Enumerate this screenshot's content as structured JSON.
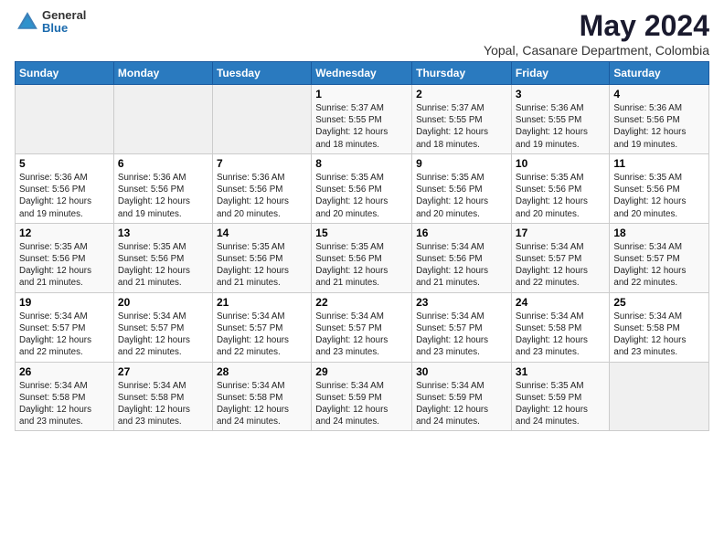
{
  "logo": {
    "general": "General",
    "blue": "Blue"
  },
  "title": "May 2024",
  "subtitle": "Yopal, Casanare Department, Colombia",
  "days_of_week": [
    "Sunday",
    "Monday",
    "Tuesday",
    "Wednesday",
    "Thursday",
    "Friday",
    "Saturday"
  ],
  "weeks": [
    [
      {
        "day": "",
        "info": ""
      },
      {
        "day": "",
        "info": ""
      },
      {
        "day": "",
        "info": ""
      },
      {
        "day": "1",
        "info": "Sunrise: 5:37 AM\nSunset: 5:55 PM\nDaylight: 12 hours\nand 18 minutes."
      },
      {
        "day": "2",
        "info": "Sunrise: 5:37 AM\nSunset: 5:55 PM\nDaylight: 12 hours\nand 18 minutes."
      },
      {
        "day": "3",
        "info": "Sunrise: 5:36 AM\nSunset: 5:55 PM\nDaylight: 12 hours\nand 19 minutes."
      },
      {
        "day": "4",
        "info": "Sunrise: 5:36 AM\nSunset: 5:56 PM\nDaylight: 12 hours\nand 19 minutes."
      }
    ],
    [
      {
        "day": "5",
        "info": "Sunrise: 5:36 AM\nSunset: 5:56 PM\nDaylight: 12 hours\nand 19 minutes."
      },
      {
        "day": "6",
        "info": "Sunrise: 5:36 AM\nSunset: 5:56 PM\nDaylight: 12 hours\nand 19 minutes."
      },
      {
        "day": "7",
        "info": "Sunrise: 5:36 AM\nSunset: 5:56 PM\nDaylight: 12 hours\nand 20 minutes."
      },
      {
        "day": "8",
        "info": "Sunrise: 5:35 AM\nSunset: 5:56 PM\nDaylight: 12 hours\nand 20 minutes."
      },
      {
        "day": "9",
        "info": "Sunrise: 5:35 AM\nSunset: 5:56 PM\nDaylight: 12 hours\nand 20 minutes."
      },
      {
        "day": "10",
        "info": "Sunrise: 5:35 AM\nSunset: 5:56 PM\nDaylight: 12 hours\nand 20 minutes."
      },
      {
        "day": "11",
        "info": "Sunrise: 5:35 AM\nSunset: 5:56 PM\nDaylight: 12 hours\nand 20 minutes."
      }
    ],
    [
      {
        "day": "12",
        "info": "Sunrise: 5:35 AM\nSunset: 5:56 PM\nDaylight: 12 hours\nand 21 minutes."
      },
      {
        "day": "13",
        "info": "Sunrise: 5:35 AM\nSunset: 5:56 PM\nDaylight: 12 hours\nand 21 minutes."
      },
      {
        "day": "14",
        "info": "Sunrise: 5:35 AM\nSunset: 5:56 PM\nDaylight: 12 hours\nand 21 minutes."
      },
      {
        "day": "15",
        "info": "Sunrise: 5:35 AM\nSunset: 5:56 PM\nDaylight: 12 hours\nand 21 minutes."
      },
      {
        "day": "16",
        "info": "Sunrise: 5:34 AM\nSunset: 5:56 PM\nDaylight: 12 hours\nand 21 minutes."
      },
      {
        "day": "17",
        "info": "Sunrise: 5:34 AM\nSunset: 5:57 PM\nDaylight: 12 hours\nand 22 minutes."
      },
      {
        "day": "18",
        "info": "Sunrise: 5:34 AM\nSunset: 5:57 PM\nDaylight: 12 hours\nand 22 minutes."
      }
    ],
    [
      {
        "day": "19",
        "info": "Sunrise: 5:34 AM\nSunset: 5:57 PM\nDaylight: 12 hours\nand 22 minutes."
      },
      {
        "day": "20",
        "info": "Sunrise: 5:34 AM\nSunset: 5:57 PM\nDaylight: 12 hours\nand 22 minutes."
      },
      {
        "day": "21",
        "info": "Sunrise: 5:34 AM\nSunset: 5:57 PM\nDaylight: 12 hours\nand 22 minutes."
      },
      {
        "day": "22",
        "info": "Sunrise: 5:34 AM\nSunset: 5:57 PM\nDaylight: 12 hours\nand 23 minutes."
      },
      {
        "day": "23",
        "info": "Sunrise: 5:34 AM\nSunset: 5:57 PM\nDaylight: 12 hours\nand 23 minutes."
      },
      {
        "day": "24",
        "info": "Sunrise: 5:34 AM\nSunset: 5:58 PM\nDaylight: 12 hours\nand 23 minutes."
      },
      {
        "day": "25",
        "info": "Sunrise: 5:34 AM\nSunset: 5:58 PM\nDaylight: 12 hours\nand 23 minutes."
      }
    ],
    [
      {
        "day": "26",
        "info": "Sunrise: 5:34 AM\nSunset: 5:58 PM\nDaylight: 12 hours\nand 23 minutes."
      },
      {
        "day": "27",
        "info": "Sunrise: 5:34 AM\nSunset: 5:58 PM\nDaylight: 12 hours\nand 23 minutes."
      },
      {
        "day": "28",
        "info": "Sunrise: 5:34 AM\nSunset: 5:58 PM\nDaylight: 12 hours\nand 24 minutes."
      },
      {
        "day": "29",
        "info": "Sunrise: 5:34 AM\nSunset: 5:59 PM\nDaylight: 12 hours\nand 24 minutes."
      },
      {
        "day": "30",
        "info": "Sunrise: 5:34 AM\nSunset: 5:59 PM\nDaylight: 12 hours\nand 24 minutes."
      },
      {
        "day": "31",
        "info": "Sunrise: 5:35 AM\nSunset: 5:59 PM\nDaylight: 12 hours\nand 24 minutes."
      },
      {
        "day": "",
        "info": ""
      }
    ]
  ]
}
